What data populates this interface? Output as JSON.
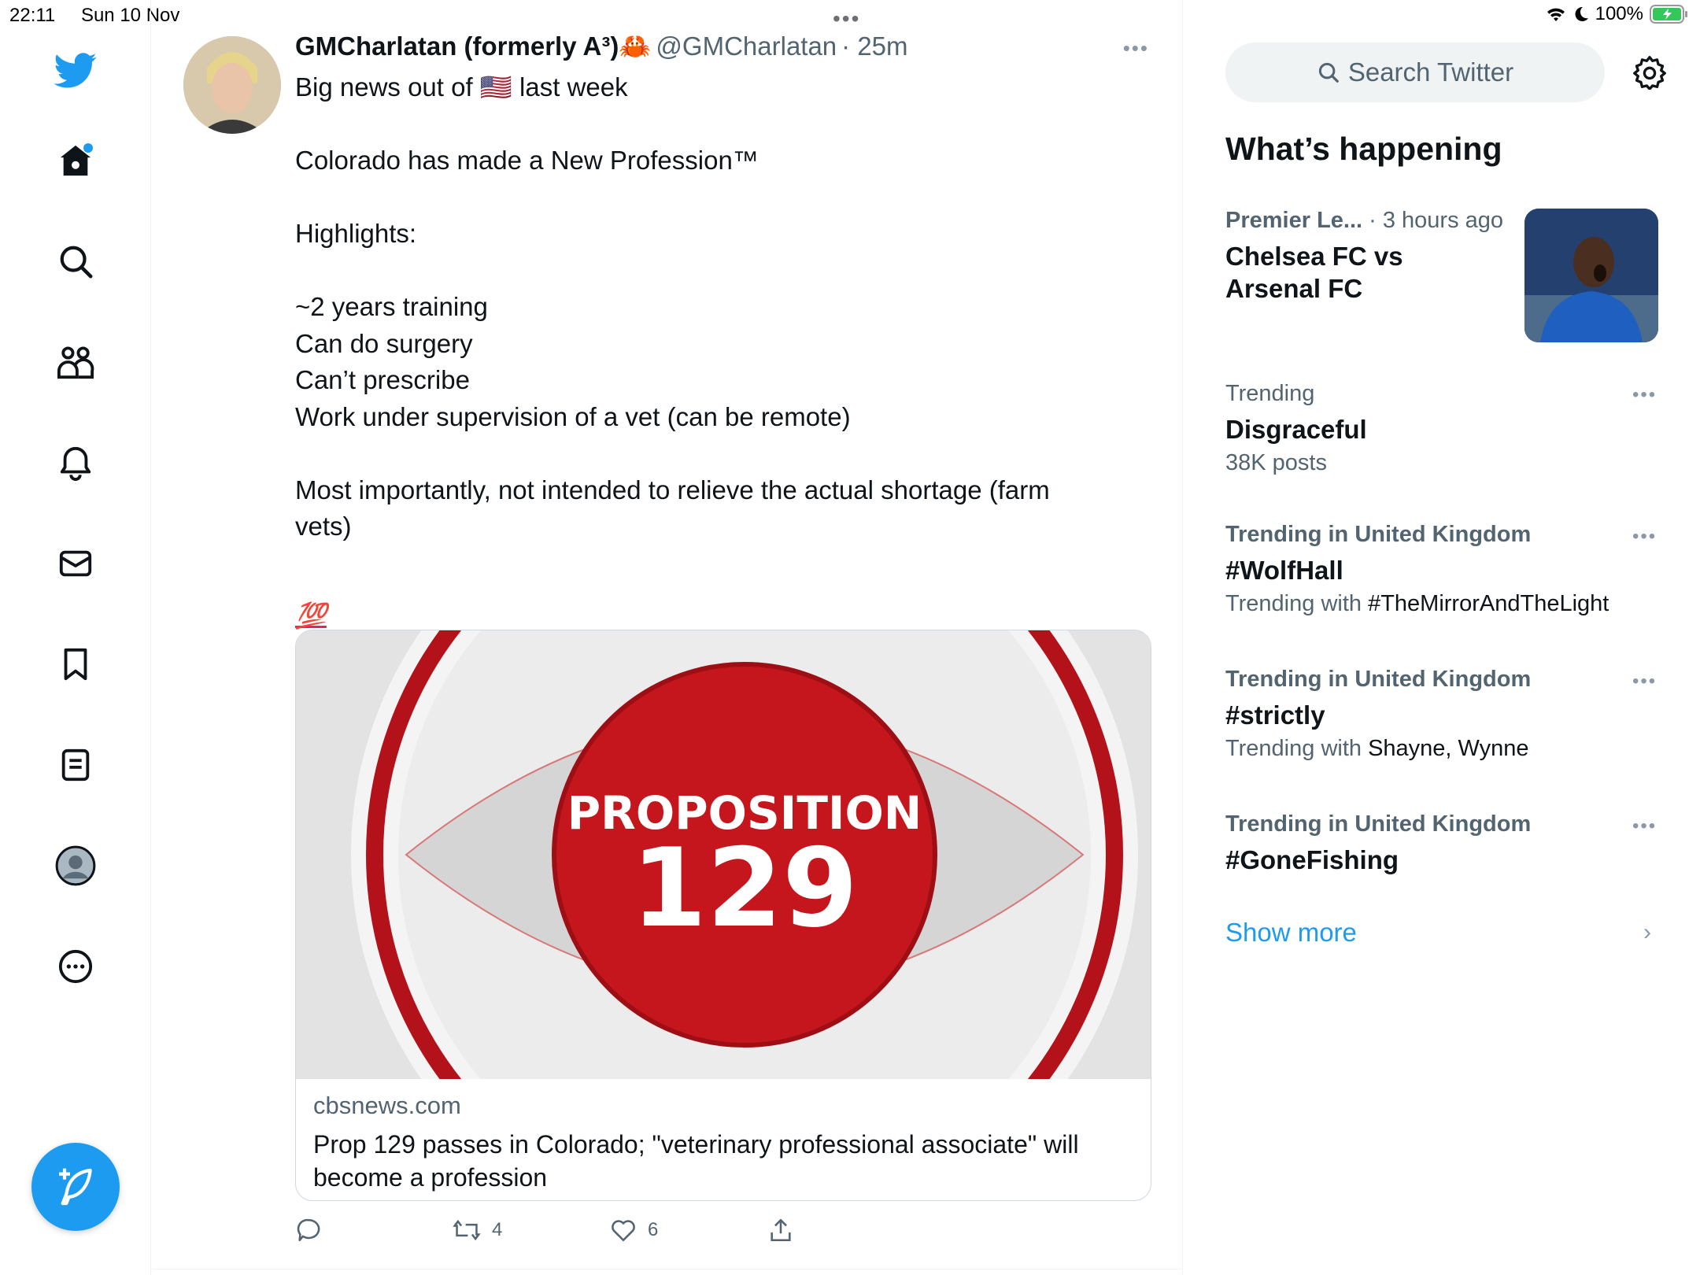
{
  "status_bar": {
    "time": "22:11",
    "date": "Sun 10 Nov",
    "battery": "100%"
  },
  "nav": {
    "items": [
      "twitter-logo",
      "home-icon",
      "explore-icon",
      "communities-icon",
      "notifications-icon",
      "messages-icon",
      "bookmarks-icon",
      "lists-icon",
      "profile-icon",
      "more-icon"
    ],
    "compose_icon": "compose-icon"
  },
  "tweet": {
    "name": "GMCharlatan (formerly A³)🦀",
    "handle": "@GMCharlatan",
    "time": "· 25m",
    "lines": [
      "Big news out of 🇺🇸 last week",
      "",
      "Colorado has made a New Profession™",
      "",
      "Highlights:",
      "",
      "~2 years training",
      "Can do surgery",
      "Can’t prescribe",
      "Work under supervision of a vet (can be remote)",
      "",
      "Most importantly, not intended to relieve the actual shortage (farm vets)"
    ],
    "emoji": "💯",
    "card": {
      "image_text_1": "PROPOSITION",
      "image_text_2": "129",
      "domain": "cbsnews.com",
      "title": "Prop 129 passes in Colorado; \"veterinary professional associate\" will become a profession"
    },
    "actions": {
      "retweets": "4",
      "likes": "6"
    }
  },
  "sidebar": {
    "search_placeholder": "Search Twitter",
    "whats_happening": "What’s happening",
    "news": {
      "category": "Premier Le...",
      "time": " · 3 hours ago",
      "title_line1": "Chelsea FC vs",
      "title_line2": "Arsenal FC"
    },
    "trends": [
      {
        "context": "Trending",
        "topic": "Disgraceful",
        "detail": "38K posts",
        "with": ""
      },
      {
        "context": "Trending in United Kingdom",
        "topic": "#WolfHall",
        "detail": "Trending with ",
        "with": "#TheMirrorAndTheLight"
      },
      {
        "context": "Trending in United Kingdom",
        "topic": "#strictly",
        "detail": "Trending with ",
        "with": "Shayne, Wynne"
      },
      {
        "context": "Trending in United Kingdom",
        "topic": "#GoneFishing",
        "detail": "",
        "with": ""
      }
    ],
    "show_more": "Show more"
  },
  "colors": {
    "brand_blue": "#1d9bf0",
    "secondary_text": "#536471",
    "card_red": "#c4161c"
  }
}
